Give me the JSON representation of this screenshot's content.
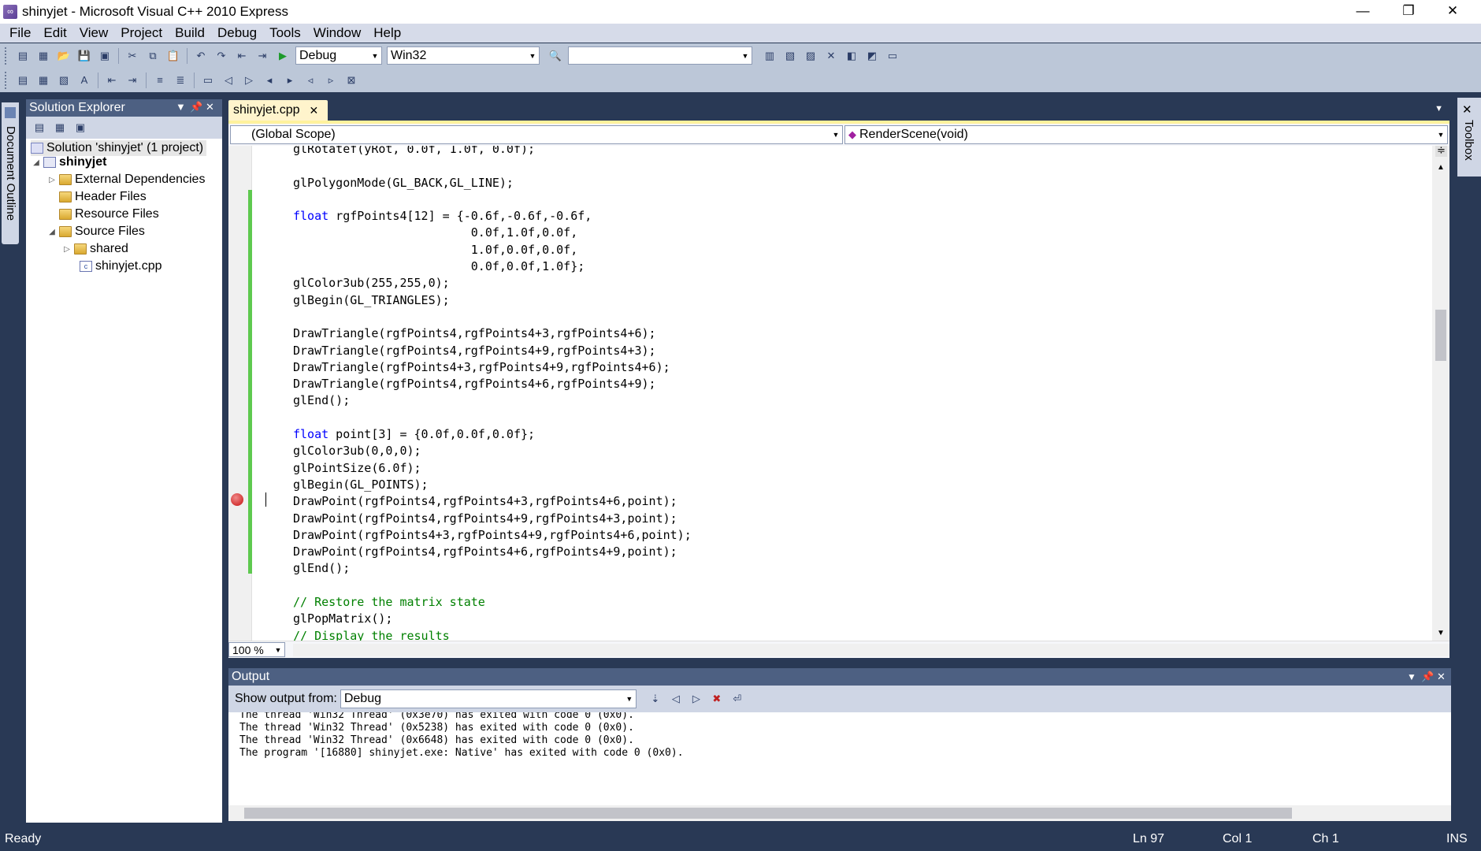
{
  "window": {
    "title": "shinyjet - Microsoft Visual C++ 2010 Express",
    "controls": {
      "min": "—",
      "restore": "❐",
      "close": "✕"
    }
  },
  "menu": [
    "File",
    "Edit",
    "View",
    "Project",
    "Build",
    "Debug",
    "Tools",
    "Window",
    "Help"
  ],
  "toolbar": {
    "config": "Debug",
    "platform": "Win32",
    "find": ""
  },
  "left_dock": {
    "label": "Document Outline"
  },
  "right_dock": {
    "label": "Toolbox"
  },
  "solution_explorer": {
    "title": "Solution Explorer",
    "items": [
      {
        "label": "Solution 'shinyjet' (1 project)"
      },
      {
        "label": "shinyjet"
      },
      {
        "label": "External Dependencies"
      },
      {
        "label": "Header Files"
      },
      {
        "label": "Resource Files"
      },
      {
        "label": "Source Files"
      },
      {
        "label": "shared"
      },
      {
        "label": "shinyjet.cpp"
      }
    ]
  },
  "editor": {
    "tab": "shinyjet.cpp",
    "scope": "(Global Scope)",
    "member": "RenderScene(void)",
    "zoom": "100 %",
    "lines": [
      {
        "t": "glRotatef(yRot, 0.0f, 1.0f, 0.0f);",
        "c": ""
      },
      {
        "t": "",
        "c": ""
      },
      {
        "t": "glPolygonMode(GL_BACK,GL_LINE);",
        "c": ""
      },
      {
        "t": "",
        "c": ""
      },
      {
        "t": "float rgfPoints4[12] = {-0.6f,-0.6f,-0.6f,",
        "c": "kwline"
      },
      {
        "t": "                         0.0f,1.0f,0.0f,",
        "c": ""
      },
      {
        "t": "                         1.0f,0.0f,0.0f,",
        "c": ""
      },
      {
        "t": "                         0.0f,0.0f,1.0f};",
        "c": ""
      },
      {
        "t": "glColor3ub(255,255,0);",
        "c": ""
      },
      {
        "t": "glBegin(GL_TRIANGLES);",
        "c": ""
      },
      {
        "t": "",
        "c": ""
      },
      {
        "t": "DrawTriangle(rgfPoints4,rgfPoints4+3,rgfPoints4+6);",
        "c": ""
      },
      {
        "t": "DrawTriangle(rgfPoints4,rgfPoints4+9,rgfPoints4+3);",
        "c": ""
      },
      {
        "t": "DrawTriangle(rgfPoints4+3,rgfPoints4+9,rgfPoints4+6);",
        "c": ""
      },
      {
        "t": "DrawTriangle(rgfPoints4,rgfPoints4+6,rgfPoints4+9);",
        "c": ""
      },
      {
        "t": "glEnd();",
        "c": ""
      },
      {
        "t": "",
        "c": ""
      },
      {
        "t": "float point[3] = {0.0f,0.0f,0.0f};",
        "c": "kwline"
      },
      {
        "t": "glColor3ub(0,0,0);",
        "c": ""
      },
      {
        "t": "glPointSize(6.0f);",
        "c": ""
      },
      {
        "t": "glBegin(GL_POINTS);",
        "c": ""
      },
      {
        "t": "DrawPoint(rgfPoints4,rgfPoints4+3,rgfPoints4+6,point);",
        "c": ""
      },
      {
        "t": "DrawPoint(rgfPoints4,rgfPoints4+9,rgfPoints4+3,point);",
        "c": ""
      },
      {
        "t": "DrawPoint(rgfPoints4+3,rgfPoints4+9,rgfPoints4+6,point);",
        "c": ""
      },
      {
        "t": "DrawPoint(rgfPoints4,rgfPoints4+6,rgfPoints4+9,point);",
        "c": ""
      },
      {
        "t": "glEnd();",
        "c": ""
      },
      {
        "t": "",
        "c": ""
      },
      {
        "t": "// Restore the matrix state",
        "c": "cm"
      },
      {
        "t": "glPopMatrix();",
        "c": ""
      },
      {
        "t": "// Display the results",
        "c": "cm"
      }
    ]
  },
  "output": {
    "title": "Output",
    "show_from_label": "Show output from:",
    "source": "Debug",
    "lines": [
      "The thread 'Win32 Thread' (0x3e70) has exited with code 0 (0x0).",
      "The thread 'Win32 Thread' (0x5238) has exited with code 0 (0x0).",
      "The thread 'Win32 Thread' (0x6648) has exited with code 0 (0x0).",
      "The program '[16880] shinyjet.exe: Native' has exited with code 0 (0x0)."
    ]
  },
  "status": {
    "text": "Ready",
    "ln": "Ln 97",
    "col": "Col 1",
    "ch": "Ch 1",
    "mode": "INS"
  }
}
